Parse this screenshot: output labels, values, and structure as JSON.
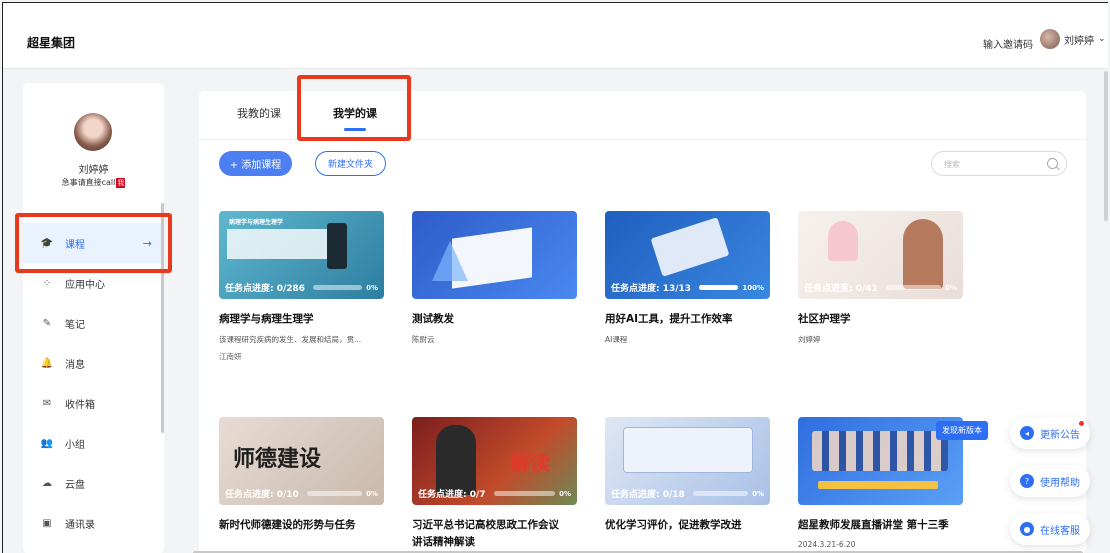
{
  "header": {
    "brand": "超星集团",
    "invite_label": "输入邀请码",
    "user_name": "刘婷婷",
    "chevron": "⌄"
  },
  "sidebar": {
    "name": "刘婷婷",
    "subtitle": "急事请直接call",
    "tag": "我",
    "items": [
      {
        "label": "课程",
        "icon": "graduation-icon",
        "glyph": "🎓",
        "active": true
      },
      {
        "label": "应用中心",
        "icon": "apps-icon",
        "glyph": "⁘"
      },
      {
        "label": "笔记",
        "icon": "note-icon",
        "glyph": "✎"
      },
      {
        "label": "消息",
        "icon": "bell-icon",
        "glyph": "🔔"
      },
      {
        "label": "收件箱",
        "icon": "inbox-icon",
        "glyph": "✉"
      },
      {
        "label": "小组",
        "icon": "group-icon",
        "glyph": "👥"
      },
      {
        "label": "云盘",
        "icon": "cloud-icon",
        "glyph": "☁"
      },
      {
        "label": "通讯录",
        "icon": "contacts-icon",
        "glyph": "▣"
      }
    ],
    "arrow": "→"
  },
  "main": {
    "tabs": [
      {
        "label": "我教的课",
        "active": false
      },
      {
        "label": "我学的课",
        "active": true
      }
    ],
    "add_course": "+ 添加课程",
    "new_folder": "新建文件夹",
    "search_placeholder": "搜索"
  },
  "courses": [
    {
      "title": "病理学与病理生理学",
      "desc": "该课程研究疾病的发生、发展和结局，贯...",
      "author": "江南妍",
      "progress_label": "任务点进度: 0/286",
      "progress": 0,
      "pct": "0%",
      "thumb_text": "病理学与病理生理学"
    },
    {
      "title": "测试教发",
      "desc": "陈尉云",
      "author": "",
      "progress_label": "",
      "progress": null,
      "pct": ""
    },
    {
      "title": "用好AI工具，提升工作效率",
      "desc": "AI课程",
      "author": "",
      "progress_label": "任务点进度: 13/13",
      "progress": 1,
      "pct": "100%"
    },
    {
      "title": "社区护理学",
      "desc": "刘婷婷",
      "author": "",
      "progress_label": "任务点进度: 0/41",
      "progress": 0,
      "pct": "0%"
    },
    {
      "title": "新时代师德建设的形势与任务",
      "desc": "",
      "author": "",
      "progress_label": "任务点进度: 0/10",
      "progress": 0,
      "pct": "0%",
      "thumb_text": "师德建设"
    },
    {
      "title": "习近平总书记高校思政工作会议",
      "title2": "讲话精神解读",
      "desc": "",
      "author": "",
      "progress_label": "任务点进度: 0/7",
      "progress": 0,
      "pct": "0%",
      "thumb_text": "解读"
    },
    {
      "title": "优化学习评价，促进教学改进",
      "desc": "",
      "author": "",
      "progress_label": "任务点进度: 0/18",
      "progress": 0,
      "pct": "0%"
    },
    {
      "title": "超星教师发展直播讲堂 第十三季",
      "desc": "2024.3.21-6.20",
      "author": "",
      "progress_label": "",
      "progress": null,
      "pct": ""
    }
  ],
  "floating": {
    "new_version": "发现新版本",
    "update": "更新公告",
    "help": "使用帮助",
    "service": "在线客服"
  }
}
